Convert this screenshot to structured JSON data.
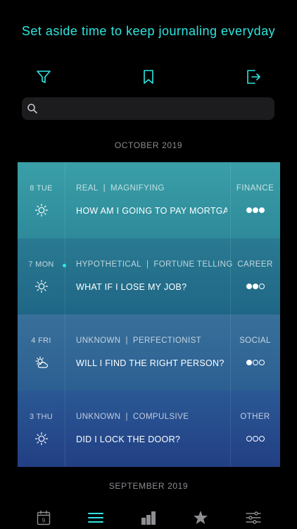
{
  "banner": {
    "text": "Set aside time to keep journaling everyday"
  },
  "colors": {
    "accent": "#2ee6e0",
    "icon": "#2ee6e0",
    "muted": "#8c8c93"
  },
  "toolbar": {
    "filter_icon": "filter-icon",
    "bookmark_icon": "bookmark-icon",
    "export_icon": "export-icon"
  },
  "search": {
    "placeholder": "",
    "value": ""
  },
  "months": {
    "current": "OCTOBER 2019",
    "previous": "SEPTEMBER 2019"
  },
  "entries": [
    {
      "day": "8 TUE",
      "weather": "sun-icon",
      "unread": false,
      "tag1": "REAL",
      "tag2": "MAGNIFYING",
      "question": "HOW AM I GOING TO PAY MORTGA...",
      "category": "FINANCE",
      "level": 3,
      "bg_top": "#3a9fa8",
      "bg_bottom": "#2e8a9a"
    },
    {
      "day": "7 MON",
      "weather": "sun-icon",
      "unread": true,
      "tag1": "HYPOTHETICAL",
      "tag2": "FORTUNE TELLING",
      "question": "WHAT IF I LOSE MY JOB?",
      "category": "CAREER",
      "level": 2,
      "bg_top": "#2a7a92",
      "bg_bottom": "#1f6686"
    },
    {
      "day": "4 FRI",
      "weather": "partly-cloudy-icon",
      "unread": false,
      "tag1": "UNKNOWN",
      "tag2": "PERFECTIONIST",
      "question": "WILL I FIND THE RIGHT PERSON?",
      "category": "SOCIAL",
      "level": 1,
      "bg_top": "#38709a",
      "bg_bottom": "#2c5f92"
    },
    {
      "day": "3 THU",
      "weather": "sun-icon",
      "unread": false,
      "tag1": "UNKNOWN",
      "tag2": "COMPULSIVE",
      "question": "DID I LOCK THE DOOR?",
      "category": "OTHER",
      "level": 0,
      "bg_top": "#2a5894",
      "bg_bottom": "#223f84"
    }
  ],
  "tabbar": {
    "calendar_day": "9",
    "items": [
      "calendar-icon",
      "list-icon",
      "bar-chart-icon",
      "star-icon",
      "sliders-icon"
    ],
    "active": "list-icon"
  }
}
